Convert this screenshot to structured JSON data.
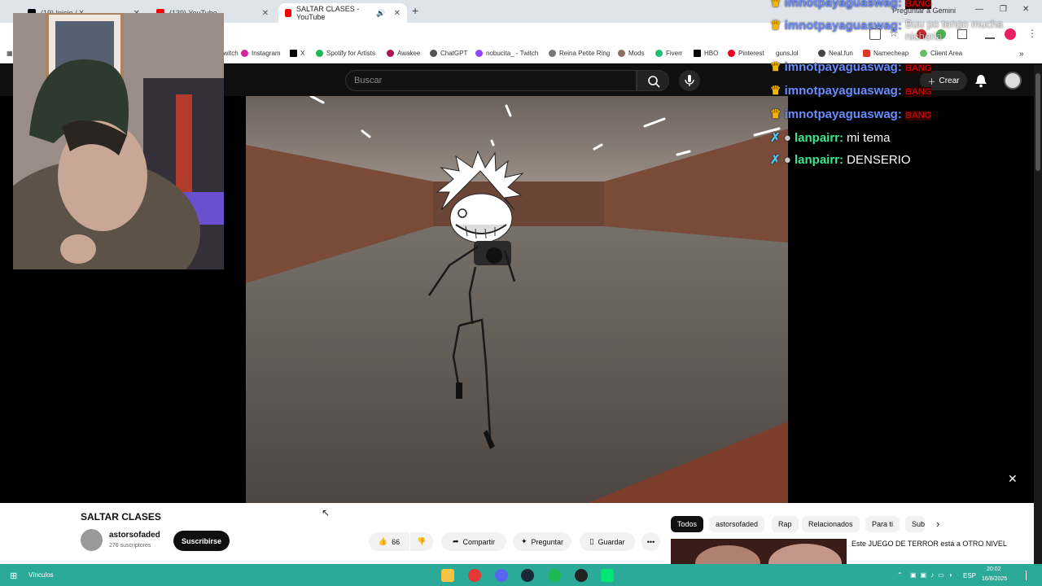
{
  "browser": {
    "tabs": [
      {
        "label": "(19) Inicio / X"
      },
      {
        "label": "(139) YouTube"
      },
      {
        "label": "SALTAR CLASES - YouTube"
      }
    ],
    "new_tab": "+",
    "gemini": "Preguntar a Gemini",
    "bookmarks": [
      "Twitch",
      "Instagram",
      "X",
      "Spotify for Artists",
      "Awakee",
      "ChatGPT",
      "nobucita_ - Twitch",
      "Reina Petite Ring",
      "Mods",
      "Fiverr",
      "HBO",
      "Pinterest",
      "guns.lol",
      "Neal.fun",
      "Namecheap",
      "Client Area"
    ]
  },
  "youtube": {
    "search_placeholder": "Buscar",
    "create_label": "Crear",
    "video_title": "SALTAR CLASES",
    "channel_name": "astorsofaded",
    "subscribers": "276 suscriptores",
    "subscribe_label": "Suscribirse",
    "likes": "66",
    "share_label": "Compartir",
    "ask_label": "Preguntar",
    "save_label": "Guardar",
    "chips": [
      "Todos",
      "astorsofaded",
      "Rap",
      "Relacionados",
      "Para ti",
      "Sub"
    ],
    "recommended": {
      "title": "Este JUEGO DE TERROR está a OTRO NIVEL"
    }
  },
  "chat": [
    {
      "user": "imnotpayaguaswag:",
      "msg": "",
      "badge": "BANG"
    },
    {
      "user": "imnotpayaguaswag:",
      "msg": "Buu po tengo mucha nicheria",
      "badge": ""
    },
    {
      "user": "imnotpayaguaswag:",
      "msg": "",
      "badge": "BANG"
    },
    {
      "user": "imnotpayaguaswag:",
      "msg": "",
      "badge": "BANG"
    },
    {
      "user": "imnotpayaguaswag:",
      "msg": "",
      "badge": "BANG"
    },
    {
      "user": "lanpairr:",
      "msg": "mi tema",
      "badge": ""
    },
    {
      "user": "lanpairr:",
      "msg": "DENSERIO",
      "badge": ""
    }
  ],
  "taskbar": {
    "vinculos": "Vínculos",
    "lang": "ESP",
    "time": "20:02",
    "date": "16/8/2025"
  },
  "colors": {
    "yt_dark": "#0f0f0f",
    "chat_user": "#6a8cff",
    "chat_green": "#3ee68f",
    "taskbar": "#2baa9a"
  }
}
